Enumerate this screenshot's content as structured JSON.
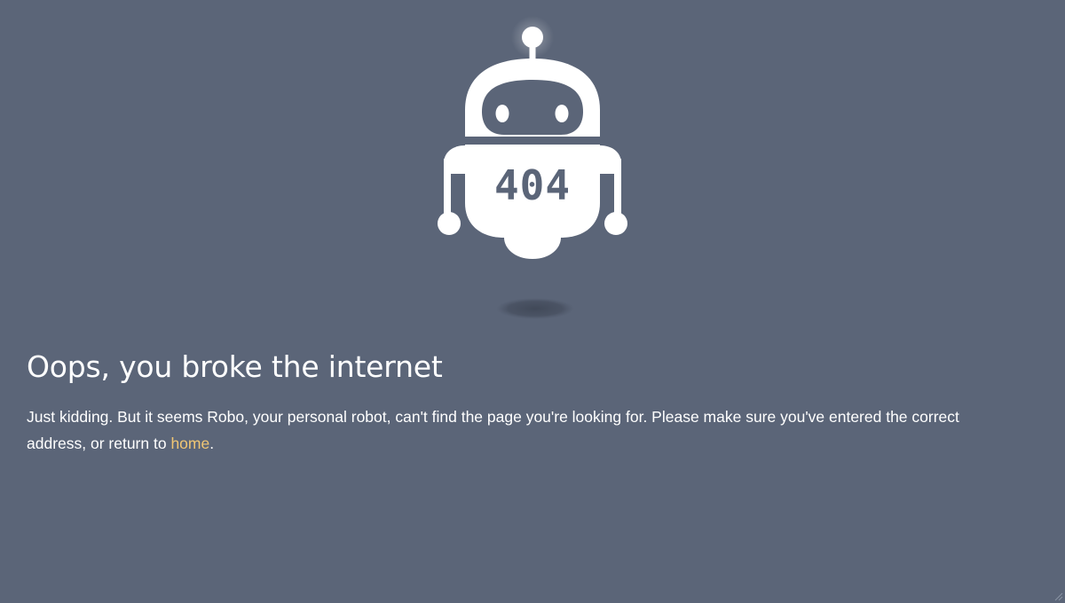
{
  "robot": {
    "code_label": "404"
  },
  "heading": "Oops, you broke the internet",
  "message": {
    "text_before_link": "Just kidding. But it seems Robo, your personal robot, can't find the page you're looking for. Please make sure you've entered the correct address, or return to ",
    "link_label": "home",
    "text_after_link": "."
  },
  "colors": {
    "background": "#5b6578",
    "robot": "#ffffff",
    "link": "#f0c674",
    "text": "#ffffff"
  }
}
